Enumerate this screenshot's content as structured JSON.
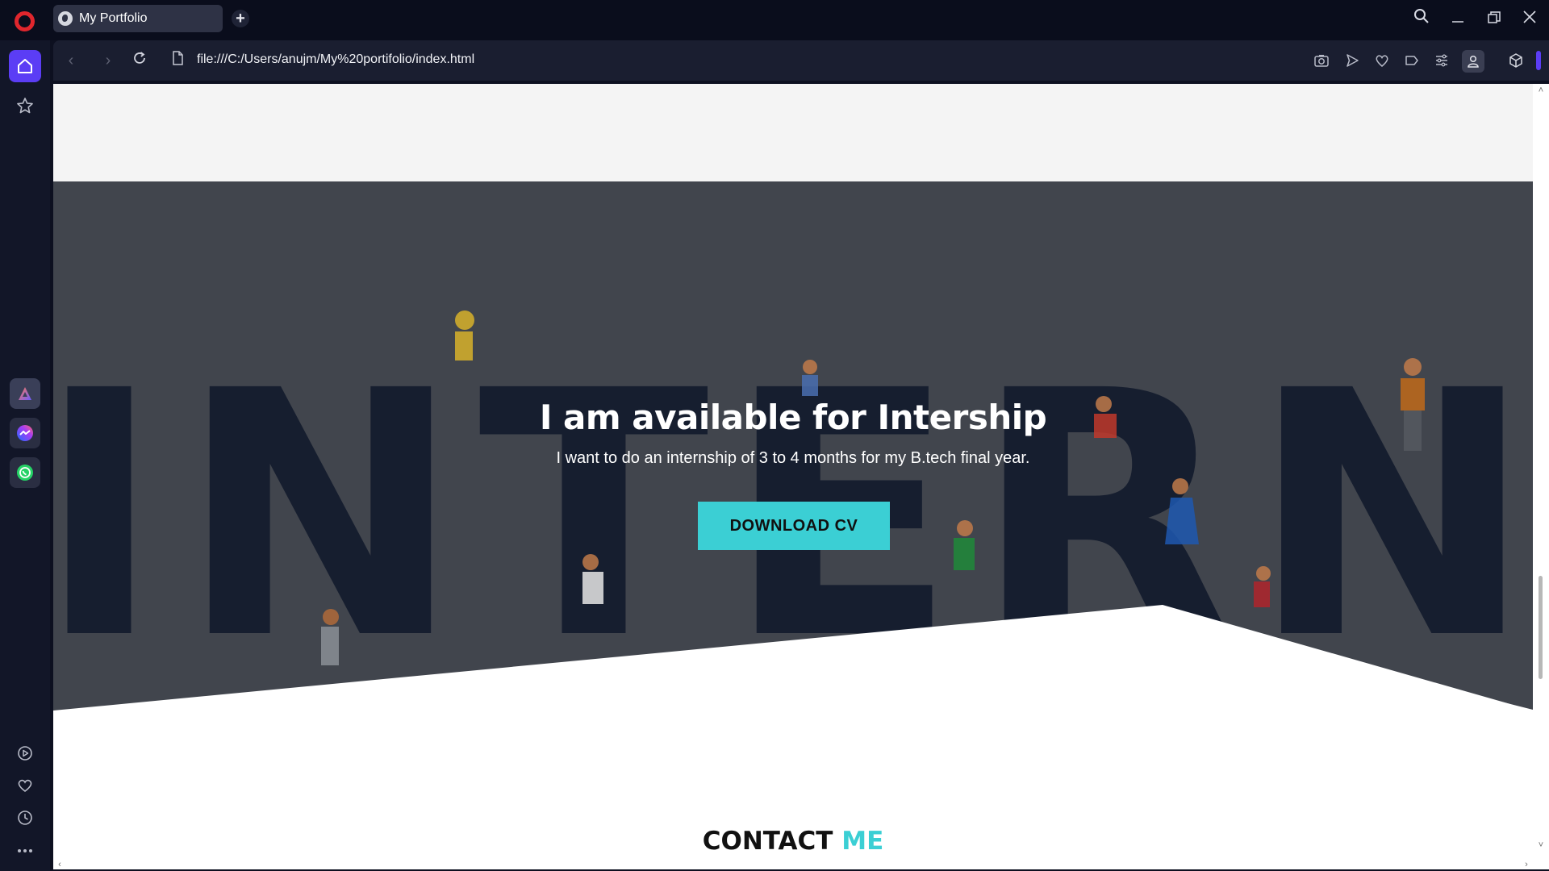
{
  "browser": {
    "tab_title": "My Portfolio",
    "new_tab_icon": "plus-icon",
    "url": "file:///C:/Users/anujm/My%20portifolio/index.html",
    "toolbar_icons": [
      "camera-icon",
      "send-icon",
      "heart-icon",
      "tag-icon",
      "easy-setup-icon",
      "profile-icon",
      "extensions-icon"
    ],
    "sidebar_icons": [
      "home-icon",
      "star-icon",
      "aria-icon",
      "messenger-icon",
      "whatsapp-icon",
      "player-icon",
      "heart-icon",
      "history-icon",
      "more-icon"
    ],
    "window_controls": [
      "search-icon",
      "minimize-icon",
      "restore-icon",
      "close-icon"
    ]
  },
  "hero": {
    "background_word": "INTERN",
    "title": "I am available for Intership",
    "subtitle": "I want to do an internship of 3 to 4 months for my B.tech final year.",
    "button_label": "DOWNLOAD CV"
  },
  "contact": {
    "heading_main": "CONTACT",
    "heading_accent": "ME"
  },
  "colors": {
    "accent": "#3bcfd4",
    "hero_bg": "#41454d",
    "browser_bg": "#0a0d1c"
  }
}
